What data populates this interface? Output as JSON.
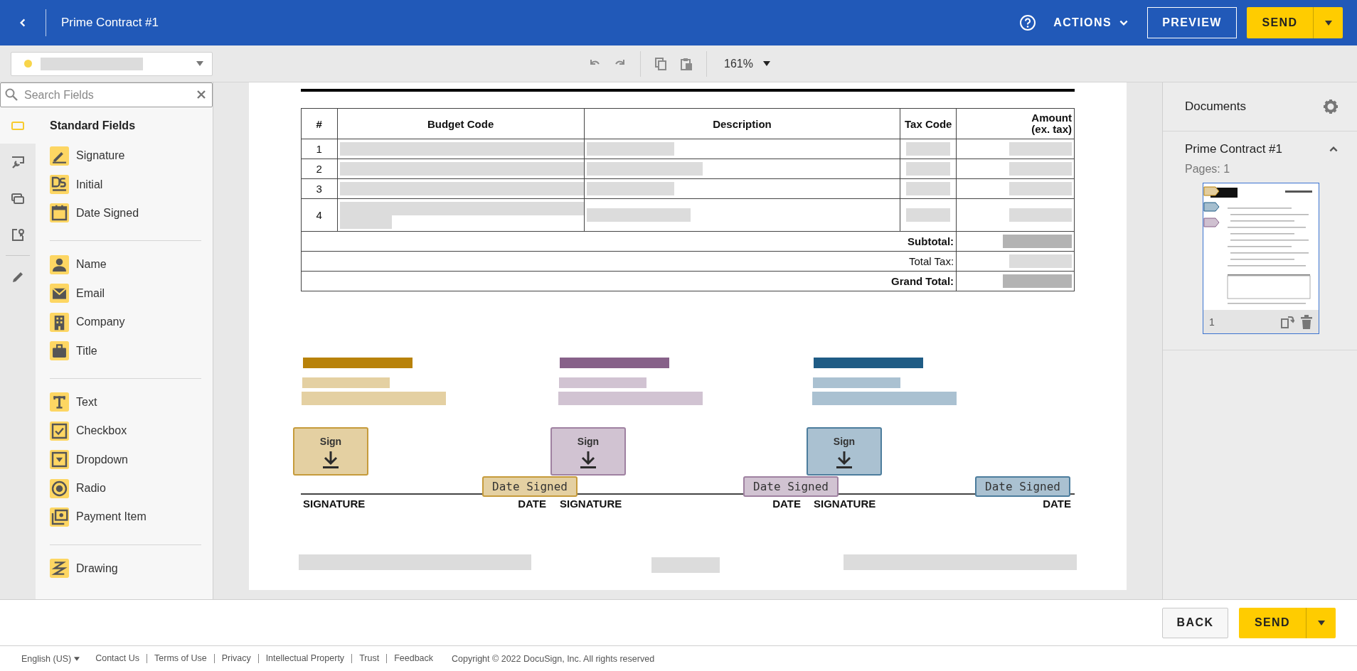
{
  "header": {
    "title": "Prime Contract #1",
    "actions": "ACTIONS",
    "preview": "PREVIEW",
    "send": "SEND"
  },
  "toolbar": {
    "recipient": {
      "color": "#f8d54a"
    },
    "zoom": "161%"
  },
  "sidebar": {
    "search": {
      "placeholder": "Search Fields"
    },
    "rail": [
      {
        "kind": "standard",
        "selected": true
      },
      {
        "kind": "custom",
        "selected": false
      },
      {
        "kind": "shared",
        "selected": false
      },
      {
        "kind": "identity",
        "selected": false
      },
      {
        "kind": "drawing",
        "selected": false
      }
    ],
    "heading": "Standard Fields",
    "groups": [
      {
        "items": [
          {
            "label": "Signature",
            "kind": "signature"
          },
          {
            "label": "Initial",
            "kind": "initial"
          },
          {
            "label": "Date Signed",
            "kind": "date"
          }
        ]
      },
      {
        "items": [
          {
            "label": "Name",
            "kind": "name"
          },
          {
            "label": "Email",
            "kind": "email"
          },
          {
            "label": "Company",
            "kind": "company"
          },
          {
            "label": "Title",
            "kind": "title"
          }
        ]
      },
      {
        "items": [
          {
            "label": "Text",
            "kind": "text"
          },
          {
            "label": "Checkbox",
            "kind": "checkbox"
          },
          {
            "label": "Dropdown",
            "kind": "dropdown"
          },
          {
            "label": "Radio",
            "kind": "radio"
          },
          {
            "label": "Payment Item",
            "kind": "payment"
          }
        ]
      },
      {
        "items": [
          {
            "label": "Drawing",
            "kind": "drawing"
          }
        ]
      }
    ]
  },
  "document": {
    "table": {
      "columns": [
        "#",
        "Budget Code",
        "Description",
        "Tax Code",
        "Amount\n(ex. tax)"
      ],
      "rows": [
        {
          "number": "1"
        },
        {
          "number": "2"
        },
        {
          "number": "3"
        },
        {
          "number": "4"
        }
      ],
      "totals": [
        {
          "label": "Subtotal:",
          "bold": true
        },
        {
          "label": "Total Tax:",
          "bold": false
        },
        {
          "label": "Grand Total:",
          "bold": true
        }
      ]
    },
    "signers": [
      {
        "color": "#b8820a",
        "sign": "Sign",
        "signature_label": "SIGNATURE",
        "date_tab": "Date Signed",
        "date_label": "DATE"
      },
      {
        "color": "#876189",
        "sign": "Sign",
        "signature_label": "SIGNATURE",
        "date_tab": "Date Signed",
        "date_label": "DATE"
      },
      {
        "color": "#1f5c85",
        "sign": "Sign",
        "signature_label": "SIGNATURE",
        "date_tab": "Date Signed",
        "date_label": "DATE"
      }
    ]
  },
  "documents_panel": {
    "title": "Documents",
    "document": {
      "name": "Prime Contract #1",
      "expanded": true,
      "pages": "Pages: 1",
      "page_number": "1"
    }
  },
  "bottom_bar": {
    "back": "BACK",
    "send": "SEND"
  },
  "footer": {
    "language": "English (US)",
    "links": [
      "Contact Us",
      "Terms of Use",
      "Privacy",
      "Intellectual Property",
      "Trust",
      "Feedback"
    ],
    "copyright": "Copyright © 2022 DocuSign, Inc. All rights reserved"
  }
}
